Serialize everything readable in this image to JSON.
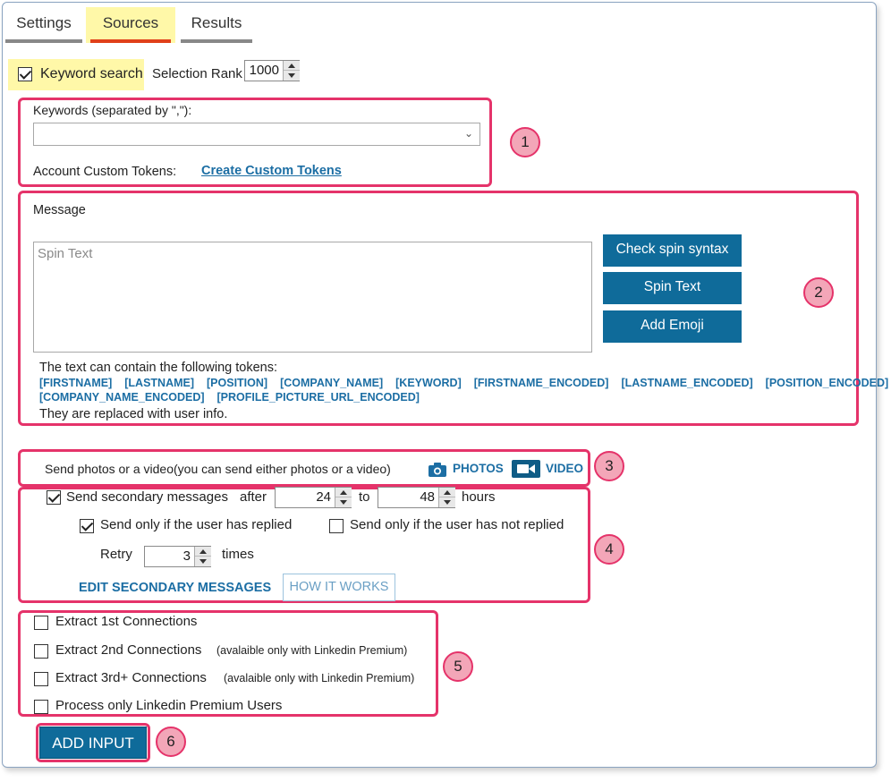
{
  "tabs": [
    {
      "label": "Settings",
      "active": false
    },
    {
      "label": "Sources",
      "active": true
    },
    {
      "label": "Results",
      "active": false
    }
  ],
  "keyword_search": {
    "label": "Keyword search",
    "checked": true
  },
  "selection_rank": {
    "label": "Selection Rank",
    "value": "1000"
  },
  "keywords": {
    "label": "Keywords (separated by \",\"):",
    "value": "",
    "custom_tokens_label": "Account Custom Tokens:",
    "custom_tokens_link": "Create Custom Tokens"
  },
  "message": {
    "label": "Message",
    "placeholder": "Spin Text",
    "buttons": [
      "Check spin syntax",
      "Spin Text",
      "Add Emoji"
    ],
    "tokens_intro": "The text can contain the following tokens:",
    "tokens_row1": [
      "[FIRSTNAME]",
      "[LASTNAME]",
      "[POSITION]",
      "[COMPANY_NAME]",
      "[KEYWORD]",
      "[FIRSTNAME_ENCODED]",
      "[LASTNAME_ENCODED]",
      "[POSITION_ENCODED]"
    ],
    "tokens_row2": [
      "[COMPANY_NAME_ENCODED]",
      "[PROFILE_PICTURE_URL_ENCODED]"
    ],
    "tokens_outro": "They are replaced with user info."
  },
  "media": {
    "label": "Send photos or a video(you can send either photos or a video)",
    "photos": "PHOTOS",
    "video": "VIDEO"
  },
  "secondary": {
    "send_label": "Send secondary messages",
    "send_checked": true,
    "after_label": "after",
    "from_value": "24",
    "to_label": "to",
    "to_value": "48",
    "hours_label": "hours",
    "replied_label": "Send only if the user has replied",
    "replied_checked": true,
    "not_replied_label": "Send only if the user has not replied",
    "not_replied_checked": false,
    "retry_label": "Retry",
    "retry_value": "3",
    "times_label": "times",
    "edit_link": "EDIT SECONDARY MESSAGES",
    "how_link": "HOW IT WORKS"
  },
  "extract": [
    {
      "label": "Extract 1st Connections",
      "note": "",
      "checked": false
    },
    {
      "label": "Extract 2nd Connections",
      "note": "(avalaible only with Linkedin Premium)",
      "checked": false
    },
    {
      "label": "Extract 3rd+ Connections",
      "note": "(avalaible only with Linkedin Premium)",
      "checked": false
    },
    {
      "label": "Process only Linkedin Premium Users",
      "note": "",
      "checked": false
    }
  ],
  "add_input": "ADD INPUT",
  "badges": [
    "1",
    "2",
    "3",
    "4",
    "5",
    "6"
  ],
  "colors": {
    "accent": "#0f6b9a",
    "highlight": "#fff8a8",
    "annotation": "#e5336a",
    "tab_active": "#e0401a"
  }
}
